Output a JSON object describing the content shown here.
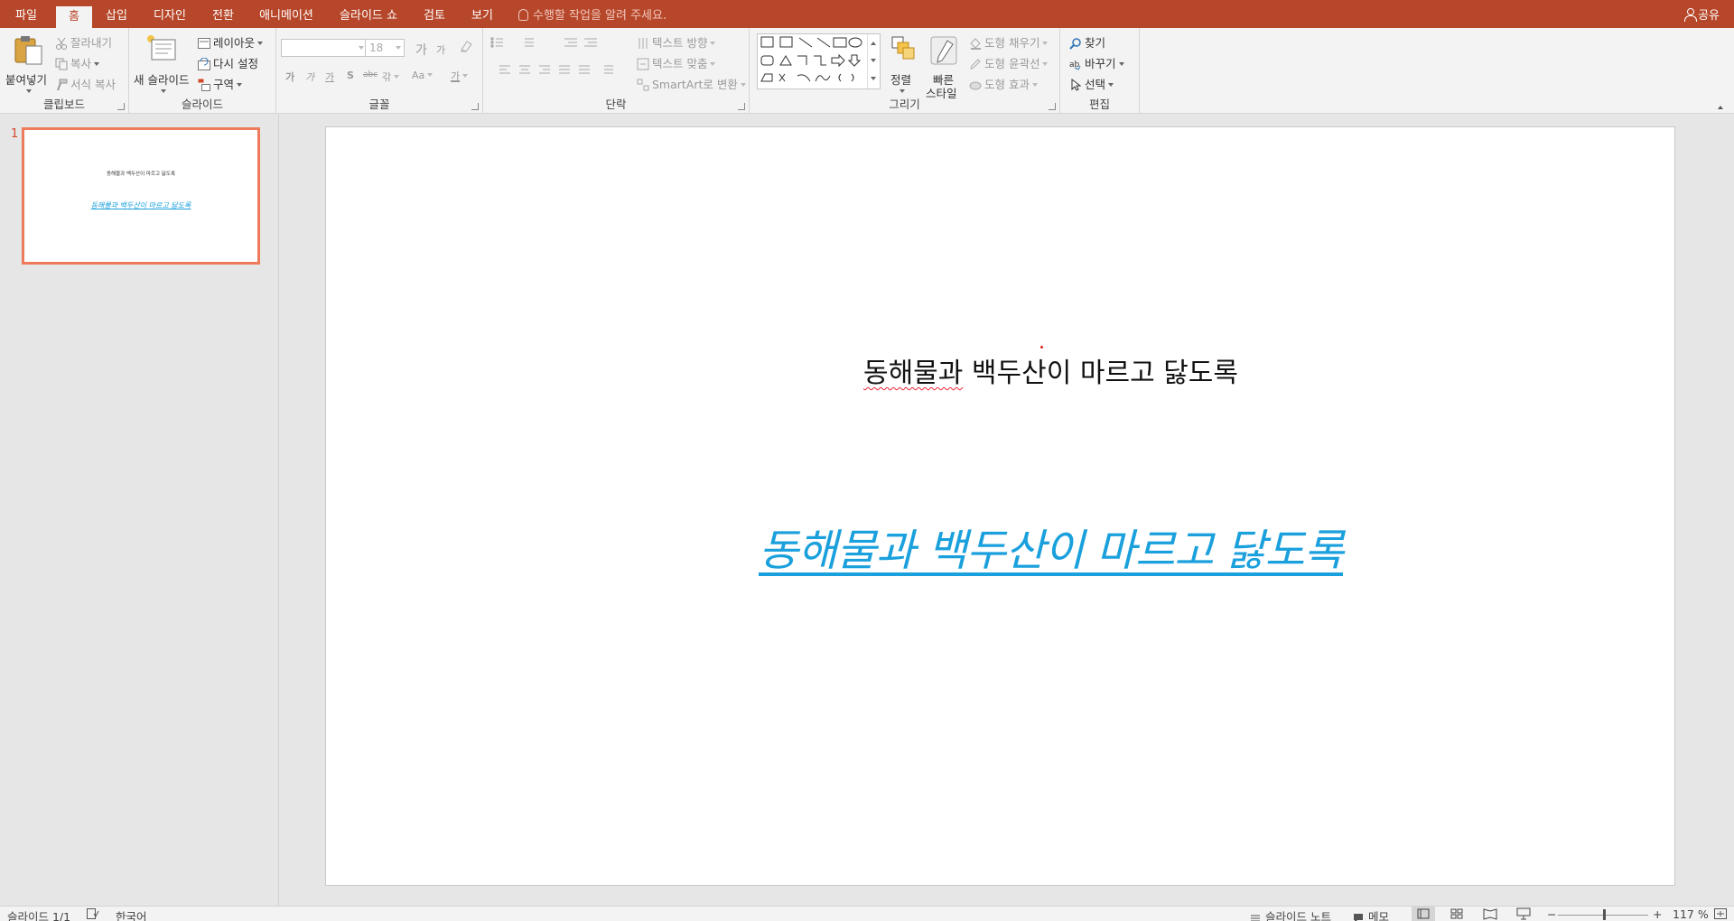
{
  "tabs": [
    {
      "label": "파일",
      "active": false
    },
    {
      "label": "홈",
      "active": true
    },
    {
      "label": "삽입",
      "active": false
    },
    {
      "label": "디자인",
      "active": false
    },
    {
      "label": "전환",
      "active": false
    },
    {
      "label": "애니메이션",
      "active": false
    },
    {
      "label": "슬라이드 쇼",
      "active": false
    },
    {
      "label": "검토",
      "active": false
    },
    {
      "label": "보기",
      "active": false
    }
  ],
  "tell_me": "수행할 작업을 알려 주세요.",
  "share": "공유",
  "ribbon": {
    "clipboard": {
      "label": "클립보드",
      "paste": "붙여넣기",
      "cut": "잘라내기",
      "copy": "복사",
      "format_painter": "서식 복사"
    },
    "slides": {
      "label": "슬라이드",
      "new_slide": "새 슬라이드",
      "layout": "레이아웃",
      "reset": "다시 설정",
      "section": "구역"
    },
    "font": {
      "label": "글꼴",
      "font_name": "",
      "font_size": "18",
      "grow": "가",
      "shrink": "가",
      "bold": "가",
      "italic": "가",
      "underline": "가",
      "shadow": "S",
      "strike": "abc",
      "spacing": "갂",
      "case": "Aa",
      "color": "가"
    },
    "paragraph": {
      "label": "단락",
      "text_direction": "텍스트 방향",
      "align_text": "텍스트 맞춤",
      "smartart": "SmartArt로 변환"
    },
    "drawing": {
      "label": "그리기",
      "arrange": "정렬",
      "quick_styles_1": "빠른",
      "quick_styles_2": "스타일",
      "shape_fill": "도형 채우기",
      "shape_outline": "도형 윤곽선",
      "shape_effects": "도형 효과"
    },
    "editing": {
      "label": "편집",
      "find": "찾기",
      "replace": "바꾸기",
      "select": "선택"
    }
  },
  "thumbnail": {
    "number": "1",
    "title": "동해물과 백두산이 마르고 닳도록",
    "link": "동해물과 백두산이 마르고 닳도록"
  },
  "slide": {
    "title_squig": "동해물과",
    "title_rest": " 백두산이 마르고 닳도록",
    "link_text": "동해물과 백두산이 마르고 닳도록",
    "link_color": "#1aa0dc"
  },
  "status": {
    "slide_info": "슬라이드 1/1",
    "language": "한국어",
    "notes": "슬라이드 노트",
    "comments": "메모",
    "zoom": "117 %"
  },
  "colors": {
    "accent": "#b7472a",
    "thumb_border": "#ee7b5a"
  }
}
